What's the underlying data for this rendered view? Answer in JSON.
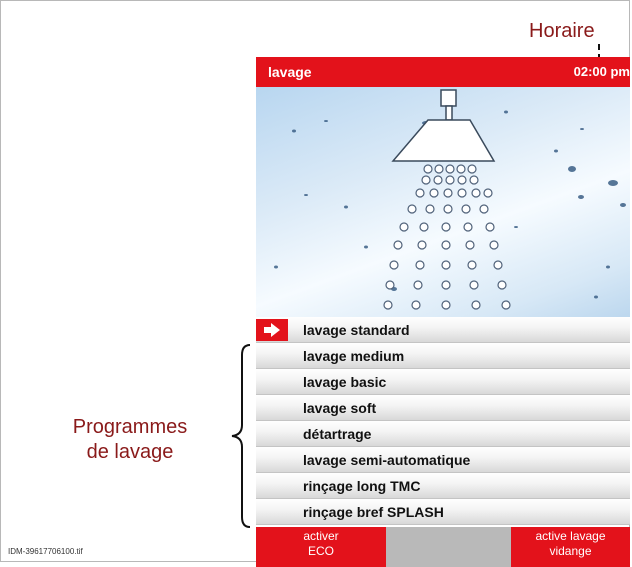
{
  "callouts": {
    "horaire": "Horaire",
    "programmes_line1": "Programmes",
    "programmes_line2": "de lavage"
  },
  "screen": {
    "title": "lavage",
    "time": "02:00 pm",
    "accent_color": "#e3121b"
  },
  "programs": [
    {
      "label": "lavage standard",
      "selected": true
    },
    {
      "label": "lavage medium"
    },
    {
      "label": "lavage basic"
    },
    {
      "label": "lavage soft"
    },
    {
      "label": "détartrage"
    },
    {
      "label": "lavage semi-automatique"
    },
    {
      "label": "rinçage long TMC"
    },
    {
      "label": "rinçage bref SPLASH"
    }
  ],
  "softkeys": {
    "left_line1": "activer",
    "left_line2": "ECO",
    "right_line1": "active lavage",
    "right_line2": "vidange"
  },
  "file_id": "IDM-39617706100.tif",
  "icons": {
    "selection_marker": "arrow-right-icon",
    "hero": "shower-head-icon"
  }
}
